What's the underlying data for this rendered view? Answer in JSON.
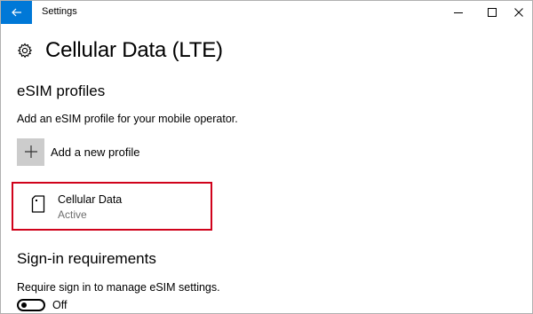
{
  "window": {
    "title": "Settings",
    "accent_color": "#0078d7"
  },
  "controls": {
    "back_icon": "back-arrow-icon",
    "minimize_icon": "minimize-icon",
    "maximize_icon": "maximize-icon",
    "close_icon": "close-icon"
  },
  "page": {
    "icon": "gear-icon",
    "title": "Cellular Data (LTE)"
  },
  "esim": {
    "heading": "eSIM profiles",
    "description": "Add an eSIM profile for your mobile operator.",
    "add_button_label": "Add a new profile",
    "add_icon": "plus-icon",
    "profiles": [
      {
        "name": "Cellular Data",
        "status": "Active",
        "icon": "sim-card-icon",
        "highlight_color": "#d0021b"
      }
    ]
  },
  "signin": {
    "heading": "Sign-in requirements",
    "description": "Require sign in to manage eSIM settings.",
    "toggle_state": "Off",
    "toggle_value": false
  }
}
